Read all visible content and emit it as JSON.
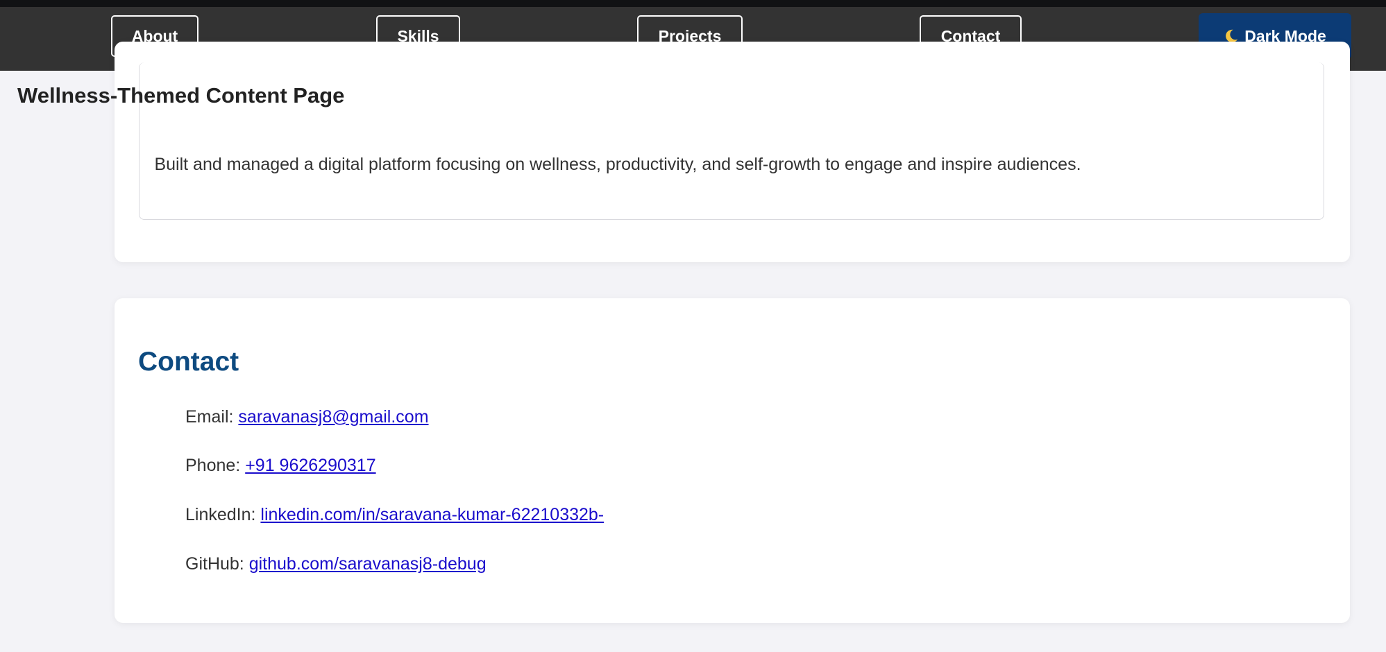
{
  "nav": {
    "items": [
      "About",
      "Skills",
      "Projects",
      "Contact"
    ],
    "dark_mode_label": "Dark Mode",
    "dark_mode_icon": "moon-icon"
  },
  "project": {
    "title": "Wellness-Themed Content Page",
    "description": "Built and managed a digital platform focusing on wellness, productivity, and self-growth to engage and inspire audiences."
  },
  "contact": {
    "heading": "Contact",
    "email": {
      "label": "Email:",
      "value": "saravanasj8@gmail.com"
    },
    "phone": {
      "label": "Phone:",
      "value": "+91 9626290317"
    },
    "linkedin": {
      "label": "LinkedIn:",
      "value": "linkedin.com/in/saravana-kumar-62210332b-"
    },
    "github": {
      "label": "GitHub:",
      "value": "github.com/saravanasj8-debug"
    }
  },
  "colors": {
    "navbar": "#333333",
    "dark_button": "#0c3b75",
    "heading": "#0d4a80",
    "link": "#1a0dcc",
    "page_background": "#f3f3f7"
  }
}
